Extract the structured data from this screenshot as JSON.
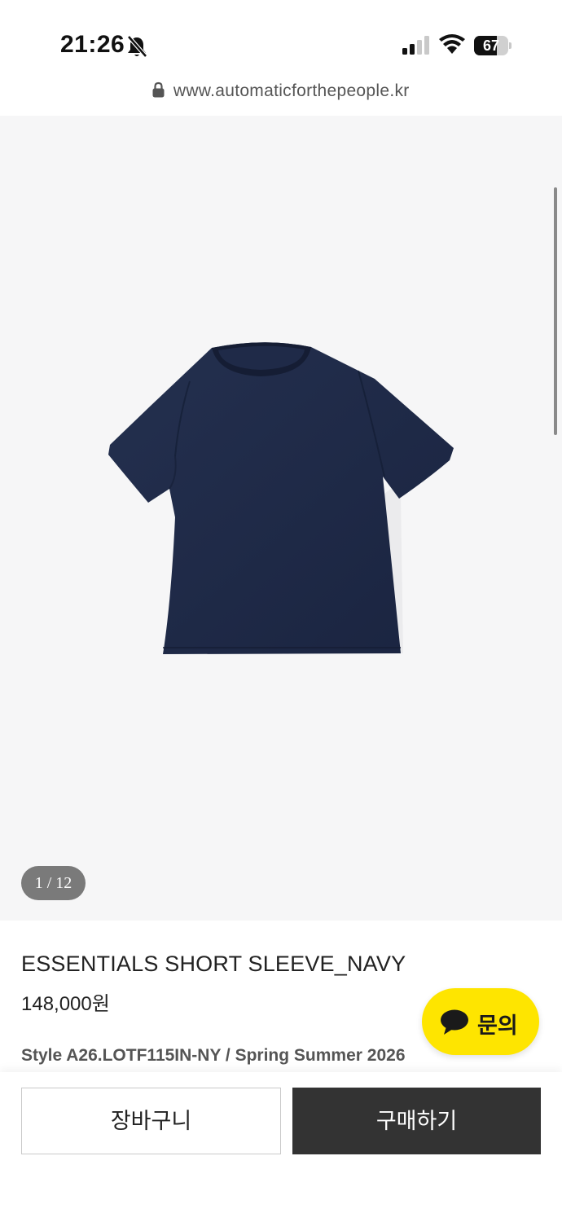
{
  "status_bar": {
    "time": "21:26",
    "battery_level": "67",
    "icons": [
      "bell-off-icon",
      "cellular-signal-icon",
      "wifi-icon",
      "battery-icon"
    ]
  },
  "browser": {
    "url": "www.automaticforthepeople.kr",
    "icons": [
      "lock-icon"
    ]
  },
  "gallery": {
    "current_page": 1,
    "total_pages": 12,
    "page_counter": "1 / 12",
    "image": "navy-short-sleeve-tshirt"
  },
  "product": {
    "title": "ESSENTIALS SHORT SLEEVE_NAVY",
    "price": "148,000원",
    "style_info": "Style A26.LOTF115IN-NY / Spring Summer 2026"
  },
  "chat": {
    "label": "문의",
    "icon": "speech-bubble-icon"
  },
  "actions": {
    "cart_label": "장바구니",
    "buy_label": "구매하기"
  },
  "colors": {
    "gallery_background": "#f6f6f7",
    "chat_button": "#fee500",
    "buy_button": "#333333",
    "shirt": "#1e2a47"
  }
}
